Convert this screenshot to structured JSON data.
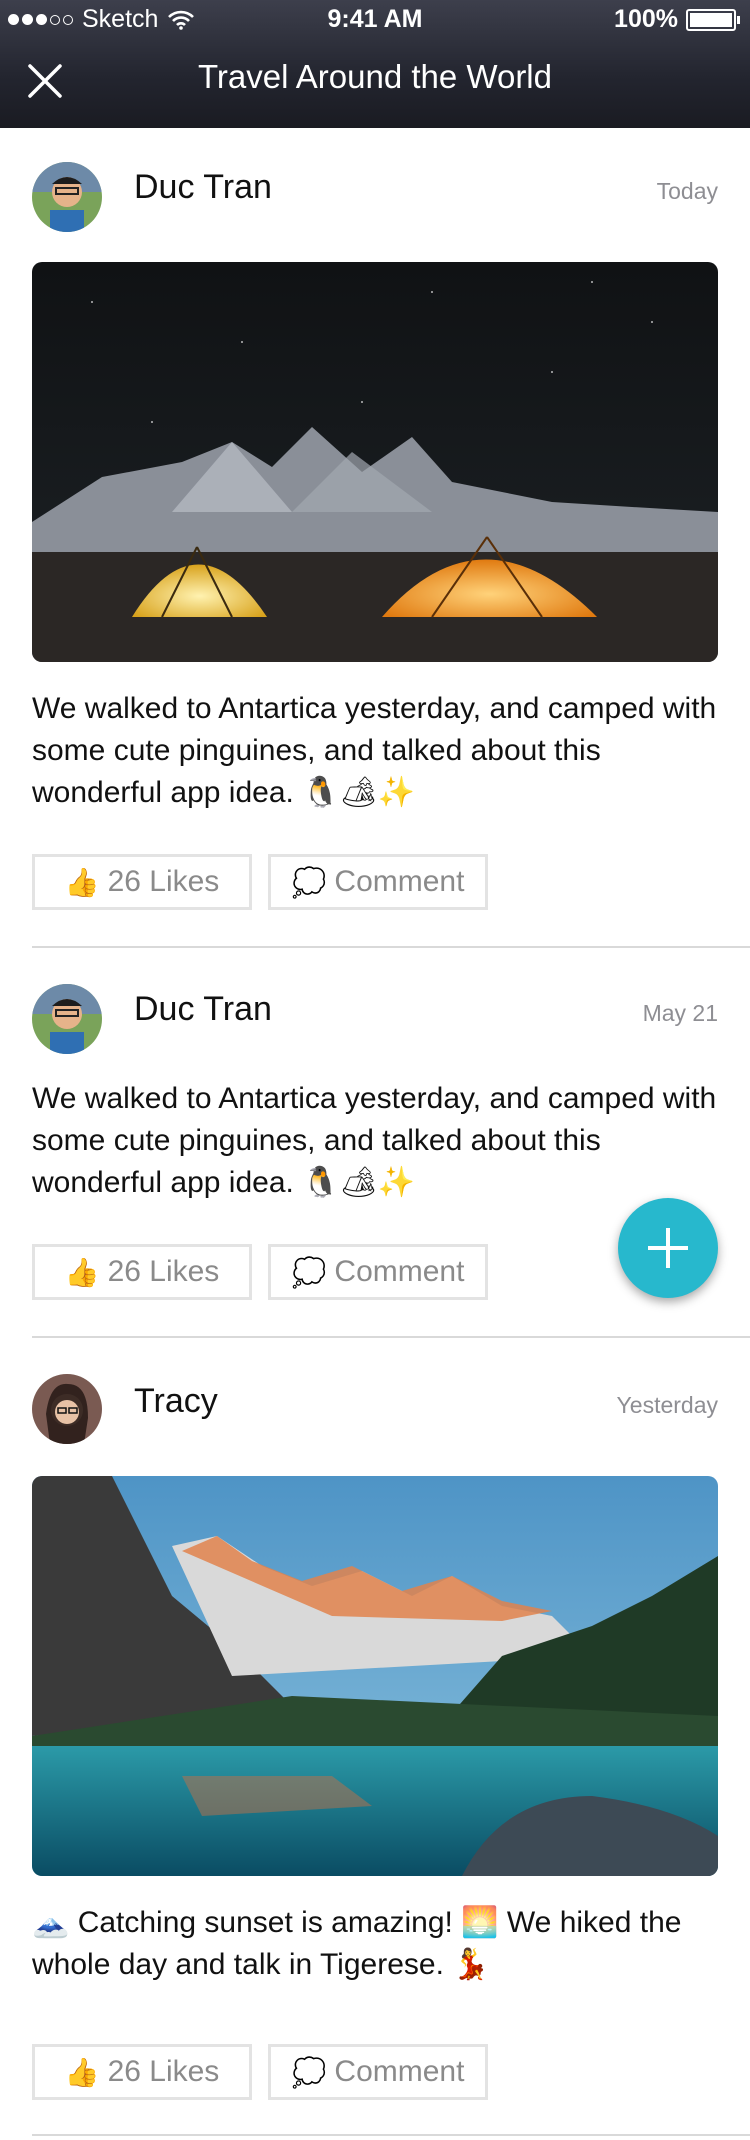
{
  "status_bar": {
    "carrier": "Sketch",
    "time": "9:41 AM",
    "battery": "100%"
  },
  "nav": {
    "title": "Travel Around the World"
  },
  "posts": [
    {
      "author": "Duc Tran",
      "date": "Today",
      "text": "We walked to Antartica yesterday, and camped with some cute pinguines, and talked about this wonderful app idea. 🐧🏕✨",
      "likes_label": "26 Likes",
      "comment_label": "Comment"
    },
    {
      "author": "Duc Tran",
      "date": "May 21",
      "text": "We walked to Antartica yesterday, and camped with some cute pinguines, and talked about this wonderful app idea. 🐧🏕✨",
      "likes_label": "26 Likes",
      "comment_label": "Comment"
    },
    {
      "author": "Tracy",
      "date": "Yesterday",
      "text": "🗻 Catching sunset is amazing! 🌅 We hiked the whole day and talk in Tigerese. 💃",
      "likes_label": "26 Likes",
      "comment_label": "Comment"
    }
  ],
  "icons": {
    "like": "👍",
    "comment": "💭"
  },
  "colors": {
    "accent": "#27b8cd",
    "header_dark": "#23252f"
  }
}
